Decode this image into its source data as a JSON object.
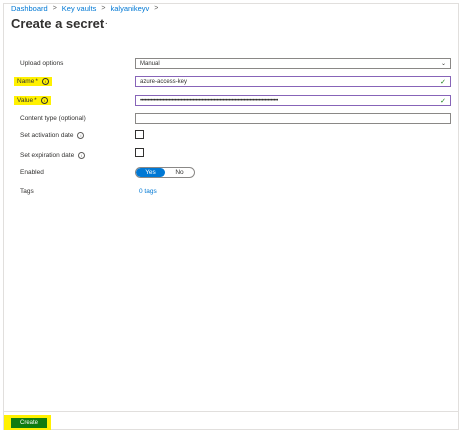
{
  "breadcrumb": [
    {
      "label": "Dashboard"
    },
    {
      "label": "Key vaults"
    },
    {
      "label": "kalyanikeyv"
    }
  ],
  "page": {
    "title": "Create a secret",
    "more_label": "···"
  },
  "form": {
    "upload_options": {
      "label": "Upload options",
      "value": "Manual"
    },
    "name": {
      "label": "Name",
      "required_mark": "*",
      "value": "azure-access-key"
    },
    "value": {
      "label": "Value",
      "required_mark": "*",
      "value": "••••••••••••••••••••••••••••••••••••••••••••••••••••••••••••••••••••••••••••••••••••••••••••"
    },
    "content_type": {
      "label": "Content type (optional)",
      "value": ""
    },
    "activation_date": {
      "label": "Set activation date",
      "checked": false
    },
    "expiration_date": {
      "label": "Set expiration date",
      "checked": false
    },
    "enabled": {
      "label": "Enabled",
      "options": [
        "Yes",
        "No"
      ],
      "selected": "Yes"
    },
    "tags": {
      "label": "Tags",
      "link": "0 tags"
    }
  },
  "footer": {
    "create_label": "Create"
  },
  "colors": {
    "accent": "#0078d4",
    "highlight": "#fff100",
    "create_button": "#107c10",
    "valid_check": "#107c10"
  }
}
